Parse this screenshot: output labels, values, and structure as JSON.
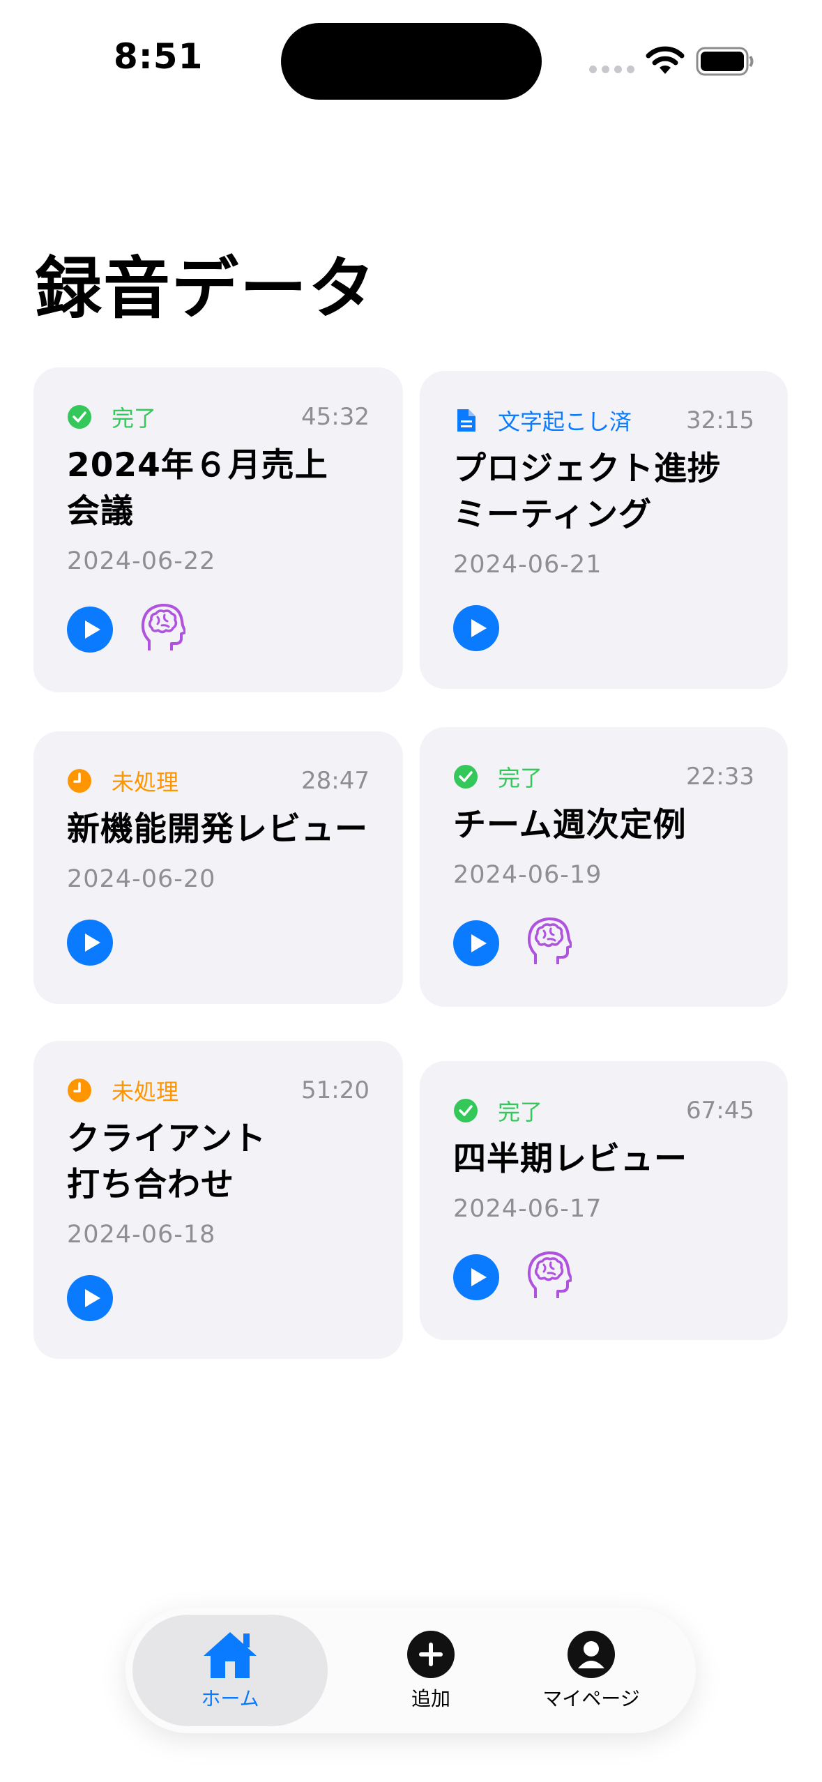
{
  "status_bar": {
    "time": "8:51"
  },
  "page_title": "録音データ",
  "colors": {
    "accent": "#0a7aff",
    "done": "#34c759",
    "transcribed": "#0a7aff",
    "pending": "#ff9500",
    "brain": "#af52de"
  },
  "recordings": [
    {
      "status": "完了",
      "status_type": "done",
      "duration": "45:32",
      "title": "2024年６月売上\n会議",
      "date": "2024-06-22",
      "has_ai": true
    },
    {
      "status": "文字起こし済",
      "status_type": "transcribed",
      "duration": "32:15",
      "title": "プロジェクト進捗\nミーティング",
      "date": "2024-06-21",
      "has_ai": false
    },
    {
      "status": "未処理",
      "status_type": "pending",
      "duration": "28:47",
      "title": "新機能開発レビュー",
      "date": "2024-06-20",
      "has_ai": false
    },
    {
      "status": "完了",
      "status_type": "done",
      "duration": "22:33",
      "title": "チーム週次定例",
      "date": "2024-06-19",
      "has_ai": true
    },
    {
      "status": "未処理",
      "status_type": "pending",
      "duration": "51:20",
      "title": "クライアント\n打ち合わせ",
      "date": "2024-06-18",
      "has_ai": false
    },
    {
      "status": "完了",
      "status_type": "done",
      "duration": "67:45",
      "title": "四半期レビュー",
      "date": "2024-06-17",
      "has_ai": true
    }
  ],
  "tab_bar": {
    "home": "ホーム",
    "add": "追加",
    "mypage": "マイページ",
    "selected": "home"
  }
}
